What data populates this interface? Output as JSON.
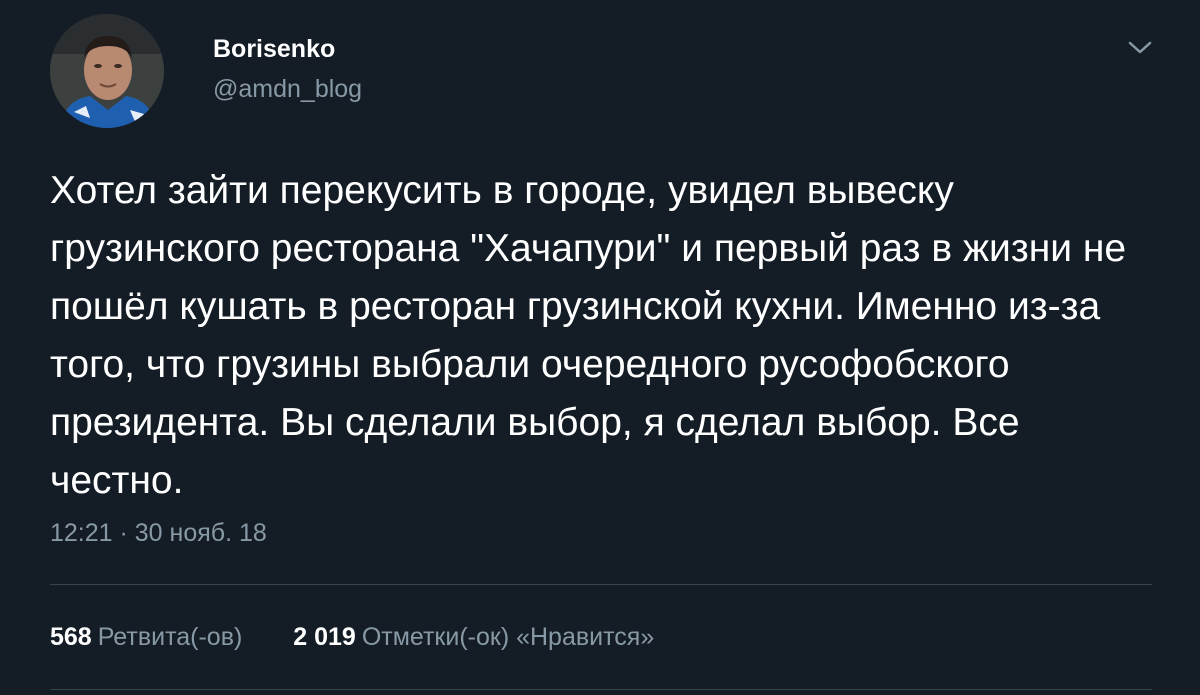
{
  "author": {
    "display_name": "Borisenko",
    "handle": "@amdn_blog",
    "avatar_icon": "profile-photo"
  },
  "menu": {
    "icon": "chevron-down-icon"
  },
  "tweet": {
    "text": "Хотел зайти перекусить в городе, увидел вывеску грузинского ресторана \"Хачапури\" и первый раз в жизни не пошёл кушать в ресторан грузинской кухни. Именно из-за того, что грузины выбрали очередного русофобского президента. Вы сделали выбор, я сделал выбор. Все честно.",
    "timestamp": "12:21 · 30 нояб. 18"
  },
  "stats": {
    "retweets_count": "568",
    "retweets_label": "Ретвита(-ов)",
    "likes_count": "2 019",
    "likes_label": "Отметки(-ок) «Нравится»"
  },
  "colors": {
    "background": "#141d26",
    "text_primary": "#ffffff",
    "text_secondary": "#8899a6",
    "divider": "#38444d"
  }
}
